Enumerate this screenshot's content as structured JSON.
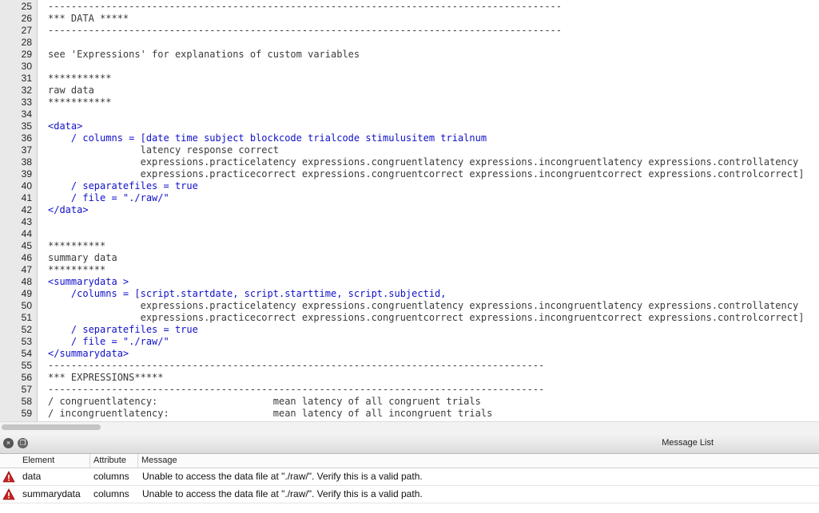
{
  "editor": {
    "lines": [
      {
        "num": "25",
        "text": "-----------------------------------------------------------------------------------------",
        "style": "plain"
      },
      {
        "num": "26",
        "text": "*** DATA *****",
        "style": "plain"
      },
      {
        "num": "27",
        "text": "-----------------------------------------------------------------------------------------",
        "style": "plain"
      },
      {
        "num": "28",
        "text": "",
        "style": "plain"
      },
      {
        "num": "29",
        "text": "see 'Expressions' for explanations of custom variables",
        "style": "plain"
      },
      {
        "num": "30",
        "text": "",
        "style": "plain"
      },
      {
        "num": "31",
        "text": "***********",
        "style": "plain"
      },
      {
        "num": "32",
        "text": "raw data",
        "style": "plain"
      },
      {
        "num": "33",
        "text": "***********",
        "style": "plain"
      },
      {
        "num": "34",
        "text": "",
        "style": "plain"
      },
      {
        "num": "35",
        "text": "<data>",
        "style": "tag"
      },
      {
        "num": "36",
        "text": "    / columns = [date time subject blockcode trialcode stimulusitem trialnum",
        "style": "attr"
      },
      {
        "num": "37",
        "text": "                latency response correct",
        "style": "plain"
      },
      {
        "num": "38",
        "text": "                expressions.practicelatency expressions.congruentlatency expressions.incongruentlatency expressions.controllatency",
        "style": "plain"
      },
      {
        "num": "39",
        "text": "                expressions.practicecorrect expressions.congruentcorrect expressions.incongruentcorrect expressions.controlcorrect]",
        "style": "plain"
      },
      {
        "num": "40",
        "text": "    / separatefiles = true",
        "style": "attr"
      },
      {
        "num": "41",
        "text": "    / file = \"./raw/\"",
        "style": "attr"
      },
      {
        "num": "42",
        "text": "</data>",
        "style": "tag"
      },
      {
        "num": "43",
        "text": "",
        "style": "plain"
      },
      {
        "num": "44",
        "text": "",
        "style": "plain"
      },
      {
        "num": "45",
        "text": "**********",
        "style": "plain"
      },
      {
        "num": "46",
        "text": "summary data",
        "style": "plain"
      },
      {
        "num": "47",
        "text": "**********",
        "style": "plain"
      },
      {
        "num": "48",
        "text": "<summarydata >",
        "style": "tag"
      },
      {
        "num": "49",
        "text": "    /columns = [script.startdate, script.starttime, script.subjectid,",
        "style": "attr"
      },
      {
        "num": "50",
        "text": "                expressions.practicelatency expressions.congruentlatency expressions.incongruentlatency expressions.controllatency",
        "style": "plain"
      },
      {
        "num": "51",
        "text": "                expressions.practicecorrect expressions.congruentcorrect expressions.incongruentcorrect expressions.controlcorrect]",
        "style": "plain"
      },
      {
        "num": "52",
        "text": "    / separatefiles = true",
        "style": "attr"
      },
      {
        "num": "53",
        "text": "    / file = \"./raw/\"",
        "style": "attr"
      },
      {
        "num": "54",
        "text": "</summarydata>",
        "style": "tag"
      },
      {
        "num": "55",
        "text": "--------------------------------------------------------------------------------------",
        "style": "plain"
      },
      {
        "num": "56",
        "text": "*** EXPRESSIONS*****",
        "style": "plain"
      },
      {
        "num": "57",
        "text": "--------------------------------------------------------------------------------------",
        "style": "plain"
      },
      {
        "num": "58",
        "text": "/ congruentlatency:                    mean latency of all congruent trials",
        "style": "plain"
      },
      {
        "num": "59",
        "text": "/ incongruentlatency:                  mean latency of all incongruent trials",
        "style": "plain"
      }
    ]
  },
  "message_panel": {
    "title": "Message List",
    "close_glyph": "×",
    "restore_glyph": "❐",
    "columns": {
      "element": "Element",
      "attribute": "Attribute",
      "message": "Message"
    },
    "rows": [
      {
        "element": "data",
        "attribute": "columns",
        "message": "Unable to access the data file at \"./raw/\". Verify this is a valid path."
      },
      {
        "element": "summarydata",
        "attribute": "columns",
        "message": "Unable to access the data file at \"./raw/\". Verify this is a valid path."
      }
    ]
  },
  "colors": {
    "warning": "#cc2222",
    "markup": "#1010c8"
  }
}
